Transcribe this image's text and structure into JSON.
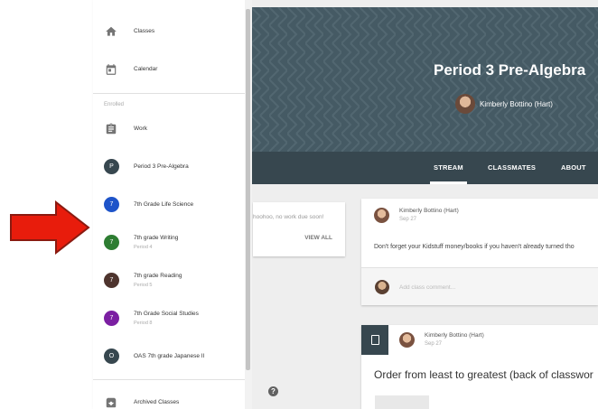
{
  "sidebar": {
    "items_top": [
      {
        "label": "Classes",
        "icon": "home-icon"
      },
      {
        "label": "Calendar",
        "icon": "calendar-icon"
      }
    ],
    "section_label": "Enrolled",
    "work_label": "Work",
    "classes": [
      {
        "initial": "P",
        "label": "Period 3 Pre-Algebra",
        "sub": "",
        "color": "#37474f"
      },
      {
        "initial": "7",
        "label": "7th Grade Life Science",
        "sub": "",
        "color": "#1e54c9"
      },
      {
        "initial": "7",
        "label": "7th grade Writing",
        "sub": "Period 4",
        "color": "#2e7d32"
      },
      {
        "initial": "7",
        "label": "7th grade Reading",
        "sub": "Period 5",
        "color": "#4e342e"
      },
      {
        "initial": "7",
        "label": "7th Grade Social Studies",
        "sub": "Period 8",
        "color": "#7b1fa2"
      },
      {
        "initial": "O",
        "label": "OAS 7th grade Japanese II",
        "sub": "",
        "color": "#37474f"
      }
    ],
    "archived_label": "Archived Classes"
  },
  "banner": {
    "title": "Period 3 Pre-Algebra",
    "teacher": "Kimberly Bottino (Hart)"
  },
  "tabs": [
    {
      "label": "STREAM",
      "active": true
    },
    {
      "label": "CLASSMATES",
      "active": false
    },
    {
      "label": "ABOUT",
      "active": false
    }
  ],
  "upcoming": {
    "text": "hoohoo, no work due soon!",
    "view_all": "VIEW ALL"
  },
  "posts": [
    {
      "author": "Kimberly Bottino (Hart)",
      "date": "Sep 27",
      "body": "Don't forget your Kidstuff money/books if you haven't already turned tho",
      "comment_placeholder": "Add class comment..."
    },
    {
      "author": "Kimberly Bottino (Hart)",
      "date": "Sep 27",
      "title": "Order from least to greatest (back of classwor"
    }
  ],
  "help_icon": "?",
  "colors": {
    "arrow": "#e81c0c",
    "banner": "#455a64",
    "tabbar": "#37474f"
  }
}
